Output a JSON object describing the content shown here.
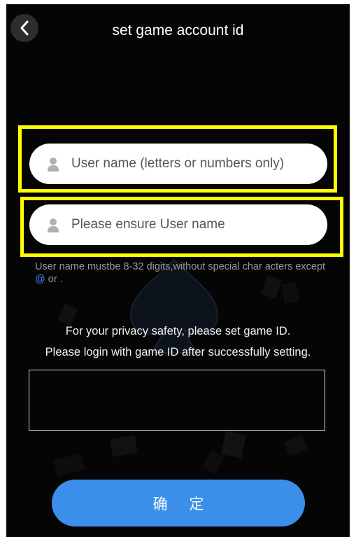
{
  "header": {
    "title": "set game account id",
    "back_icon": "chevron-left-icon"
  },
  "form": {
    "username_placeholder": "User name (letters or numbers only)",
    "username_value": "",
    "confirm_placeholder": "Please ensure User name",
    "confirm_value": "",
    "field_icon": "person-icon",
    "hint_prefix": "User name mustbe 8-32 digits,without special char acters except ",
    "hint_at": "@",
    "hint_suffix": " or ."
  },
  "info": {
    "line1": "For your privacy safety, please set game ID.",
    "line2": "Please login with game ID after successfully setting."
  },
  "confirm_button": {
    "label": "确 定"
  },
  "colors": {
    "background": "#050505",
    "highlight": "#ffff00",
    "accent": "#3b8fea",
    "hint_text": "#9a9a9a",
    "hint_at": "#3a8fff"
  }
}
